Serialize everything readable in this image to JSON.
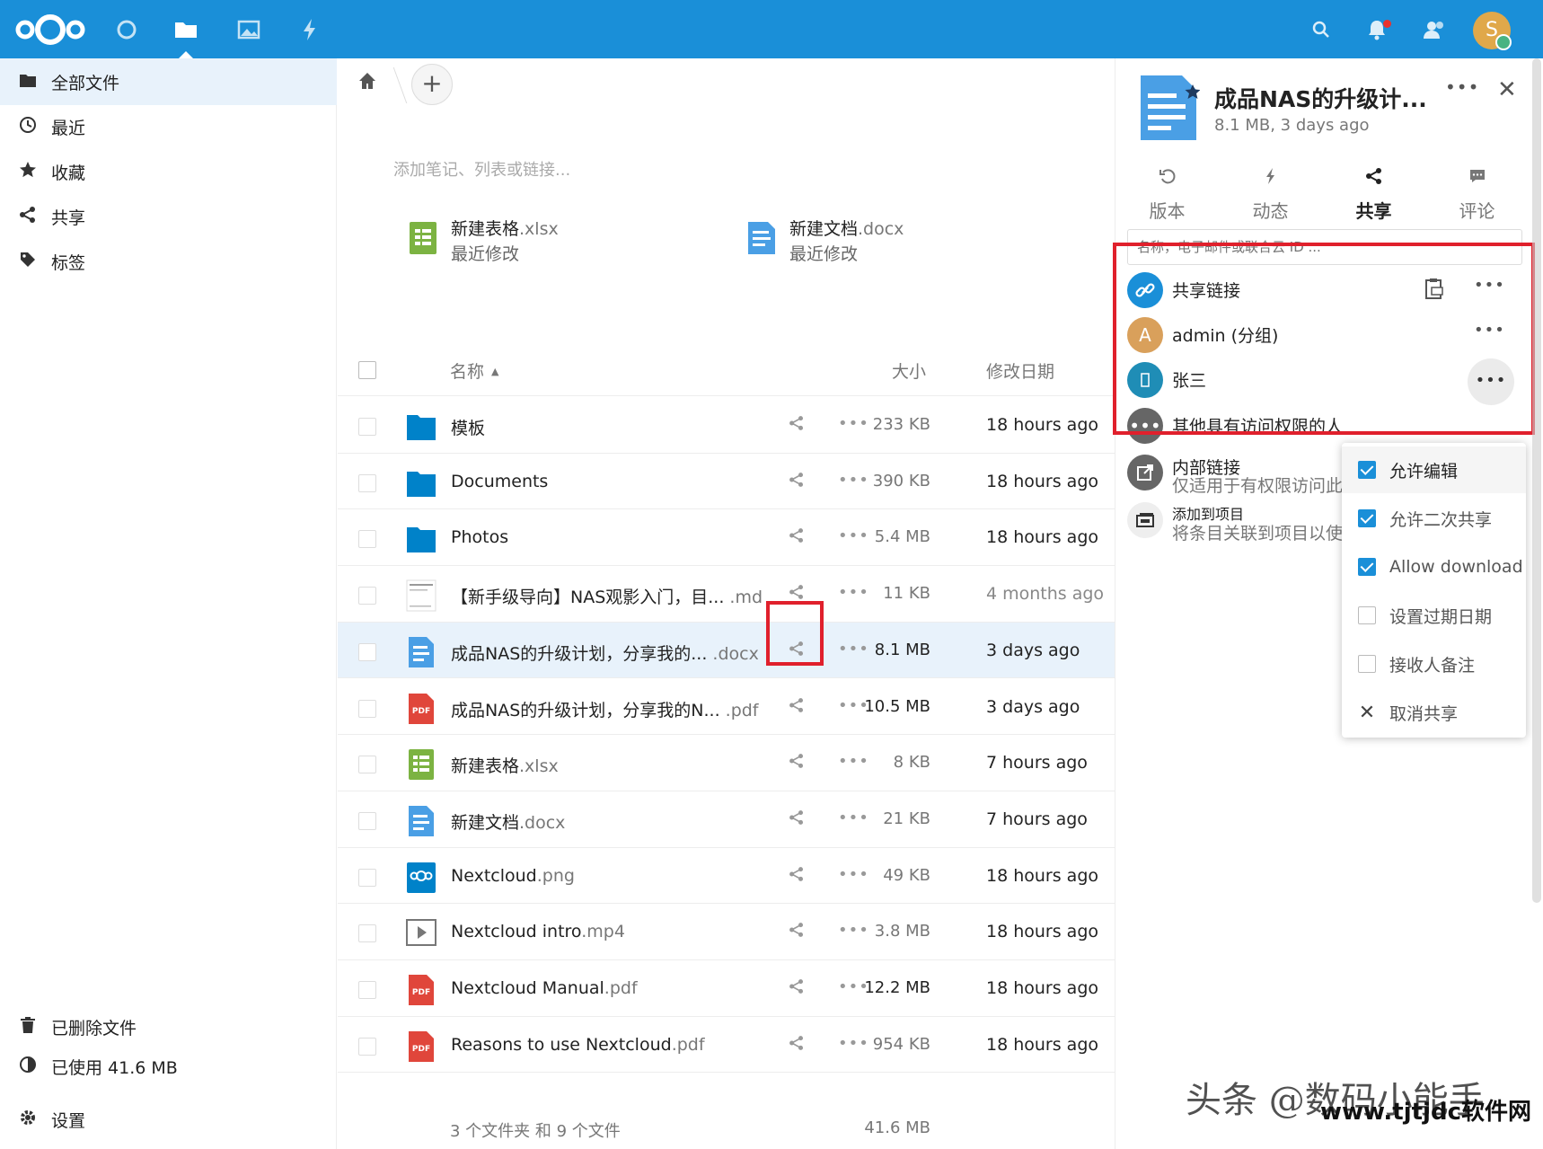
{
  "colors": {
    "accent": "#1a8fd8",
    "highlight": "#e0202c",
    "selected_row": "#e8f2fb",
    "pdf_red": "#e0463b",
    "sheet_green": "#7cb342",
    "doc_blue": "#4a9fe5"
  },
  "topbar": {
    "apps": [
      "dashboard-icon",
      "files-icon",
      "photos-icon",
      "activity-icon"
    ],
    "right_icons": [
      "search-icon",
      "bell-icon",
      "contacts-icon"
    ],
    "user_initial": "S"
  },
  "nav": {
    "items": [
      {
        "label": "全部文件",
        "icon": "folder-icon"
      },
      {
        "label": "最近",
        "icon": "clock-icon"
      },
      {
        "label": "收藏",
        "icon": "star-icon"
      },
      {
        "label": "共享",
        "icon": "share-icon"
      },
      {
        "label": "标签",
        "icon": "tag-icon"
      }
    ],
    "bottom": [
      {
        "label": "已删除文件",
        "icon": "trash-icon"
      },
      {
        "label": "已使用 41.6 MB",
        "icon": "quota-icon"
      },
      {
        "label": "设置",
        "icon": "gear-icon"
      }
    ]
  },
  "main": {
    "add_label": "+",
    "notes_placeholder": "添加笔记、列表或链接...",
    "recent": [
      {
        "name": "新建表格",
        "ext": ".xlsx",
        "sub": "最近修改",
        "type": "sheet"
      },
      {
        "name": "新建文档",
        "ext": ".docx",
        "sub": "最近修改",
        "type": "doc"
      }
    ],
    "header": {
      "name": "名称",
      "size": "大小",
      "date": "修改日期"
    },
    "files": [
      {
        "name": "模板",
        "ext": "",
        "type": "folder",
        "size": "233 KB",
        "date": "18 hours ago"
      },
      {
        "name": "Documents",
        "ext": "",
        "type": "folder",
        "size": "390 KB",
        "date": "18 hours ago"
      },
      {
        "name": "Photos",
        "ext": "",
        "type": "folder",
        "size": "5.4 MB",
        "date": "18 hours ago"
      },
      {
        "name": "【新手级导向】NAS观影入门，目...",
        "ext": " .md",
        "type": "md",
        "size": "11 KB",
        "date": "4 months ago"
      },
      {
        "name": "成品NAS的升级计划，分享我的...",
        "ext": " .docx",
        "type": "doc",
        "size": "8.1 MB",
        "date": "3 days ago"
      },
      {
        "name": "成品NAS的升级计划，分享我的N...",
        "ext": " .pdf",
        "type": "pdf",
        "size": "10.5 MB",
        "date": "3 days ago"
      },
      {
        "name": "新建表格",
        "ext": ".xlsx",
        "type": "sheet",
        "size": "8 KB",
        "date": "7 hours ago"
      },
      {
        "name": "新建文档",
        "ext": ".docx",
        "type": "doc",
        "size": "21 KB",
        "date": "7 hours ago"
      },
      {
        "name": "Nextcloud",
        "ext": ".png",
        "type": "png",
        "size": "49 KB",
        "date": "18 hours ago"
      },
      {
        "name": "Nextcloud intro",
        "ext": ".mp4",
        "type": "video",
        "size": "3.8 MB",
        "date": "18 hours ago"
      },
      {
        "name": "Nextcloud Manual",
        "ext": ".pdf",
        "type": "pdf",
        "size": "12.2 MB",
        "date": "18 hours ago"
      },
      {
        "name": "Reasons to use Nextcloud",
        "ext": ".pdf",
        "type": "pdf",
        "size": "954 KB",
        "date": "18 hours ago"
      }
    ],
    "summary": {
      "text": "3 个文件夹 和 9 个文件",
      "size": "41.6 MB"
    }
  },
  "sidebar": {
    "title": "成品NAS的升级计...",
    "subtitle": "8.1 MB, 3 days ago",
    "tabs": [
      {
        "label": "版本",
        "icon": "history-icon"
      },
      {
        "label": "动态",
        "icon": "activity-icon"
      },
      {
        "label": "共享",
        "icon": "share-icon"
      },
      {
        "label": "评论",
        "icon": "comment-icon"
      }
    ],
    "search_placeholder": "名称，电子邮件或联合云 ID ...",
    "shares": [
      {
        "label": "共享链接",
        "initial": ""
      },
      {
        "label": "admin (分组)",
        "initial": "A"
      },
      {
        "label": "张三",
        "initial": ""
      }
    ],
    "others": {
      "label": "其他具有访问权限的人"
    },
    "internal": {
      "label": "内部链接",
      "sub": "仅适用于有权限访问此"
    },
    "projects": {
      "label": "添加到项目",
      "sub": "将条目关联到项目以使"
    }
  },
  "menu": {
    "items": [
      {
        "label": "允许编辑",
        "checked": true
      },
      {
        "label": "允许二次共享",
        "checked": true
      },
      {
        "label": "Allow download",
        "checked": true
      },
      {
        "label": "设置过期日期",
        "checked": false
      },
      {
        "label": "接收人备注",
        "checked": false
      },
      {
        "label": "取消共享",
        "checked": false
      }
    ]
  },
  "watermark": {
    "line1": "头条 @数码小能手",
    "line2": "www.tjtjdc软件网"
  }
}
